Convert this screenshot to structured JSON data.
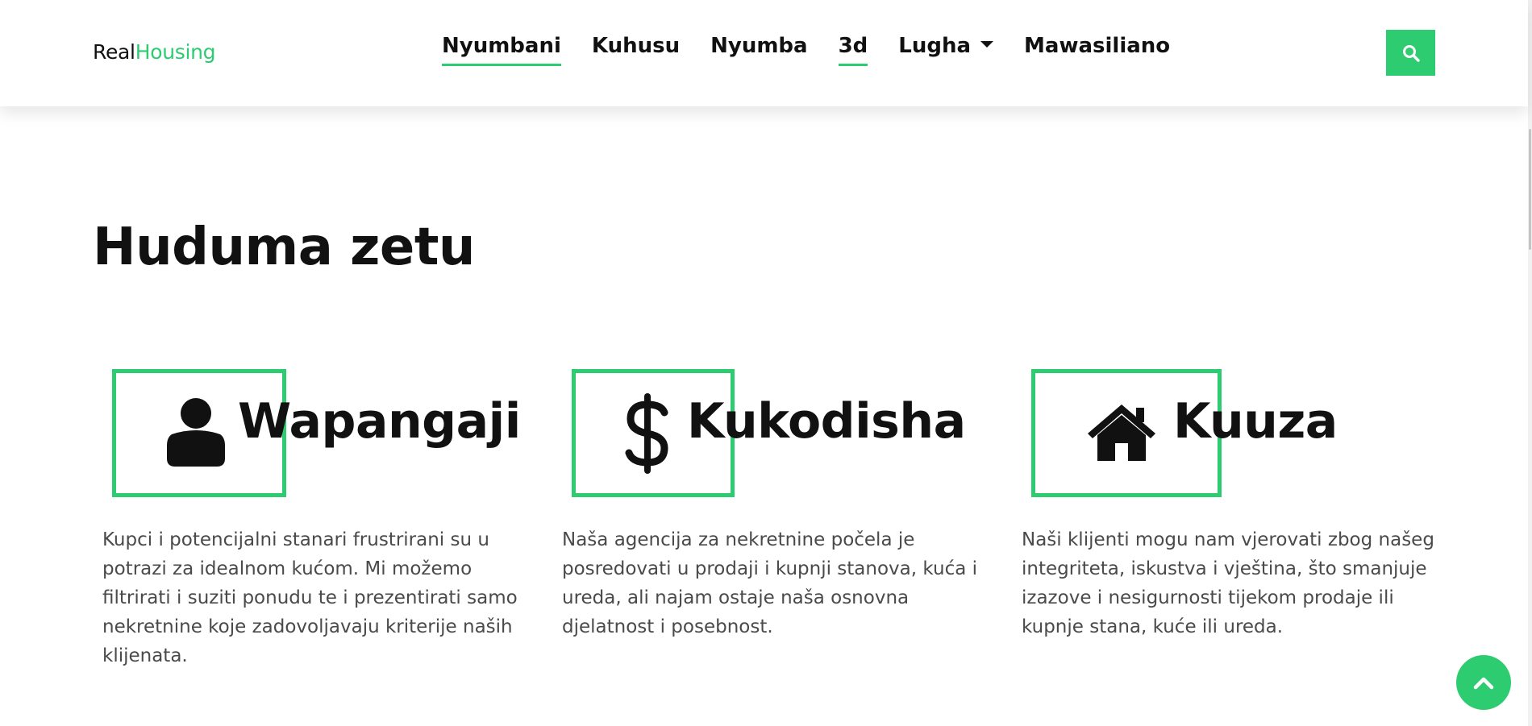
{
  "brand": {
    "part1": "Real",
    "part2": "Housing"
  },
  "nav": {
    "items": [
      {
        "label": "Nyumbani"
      },
      {
        "label": "Kuhusu"
      },
      {
        "label": "Nyumba"
      },
      {
        "label": "3d"
      },
      {
        "label": "Lugha"
      },
      {
        "label": "Mawasiliano"
      }
    ]
  },
  "main": {
    "title": "Huduma zetu",
    "services": [
      {
        "title": "Wapangaji",
        "icon": "user-icon",
        "text": "Kupci i potencijalni stanari frustrirani su u potrazi za idealnom kućom. Mi možemo filtrirati i suziti ponudu te i prezentirati samo nekretnine koje zadovoljavaju kriterije naših klijenata."
      },
      {
        "title": "Kukodisha",
        "icon": "dollar-icon",
        "text": "Naša agencija za nekretnine počela je posredovati u prodaji i kupnji stanova, kuća i ureda, ali najam ostaje naša osnovna djelatnost i posebnost."
      },
      {
        "title": "Kuuza",
        "icon": "home-icon",
        "text": "Naši klijenti mogu nam vjerovati zbog našeg integriteta, iskustva i vještina, što smanjuje izazove i nesigurnosti tijekom prodaje ili kupnje stana, kuće ili ureda."
      }
    ]
  },
  "icons": {
    "search": "search-icon",
    "back_to_top": "chevron-up-icon"
  },
  "colors": {
    "accent": "#2ecc71",
    "text": "#111111",
    "body_text": "#4a4a4a"
  }
}
